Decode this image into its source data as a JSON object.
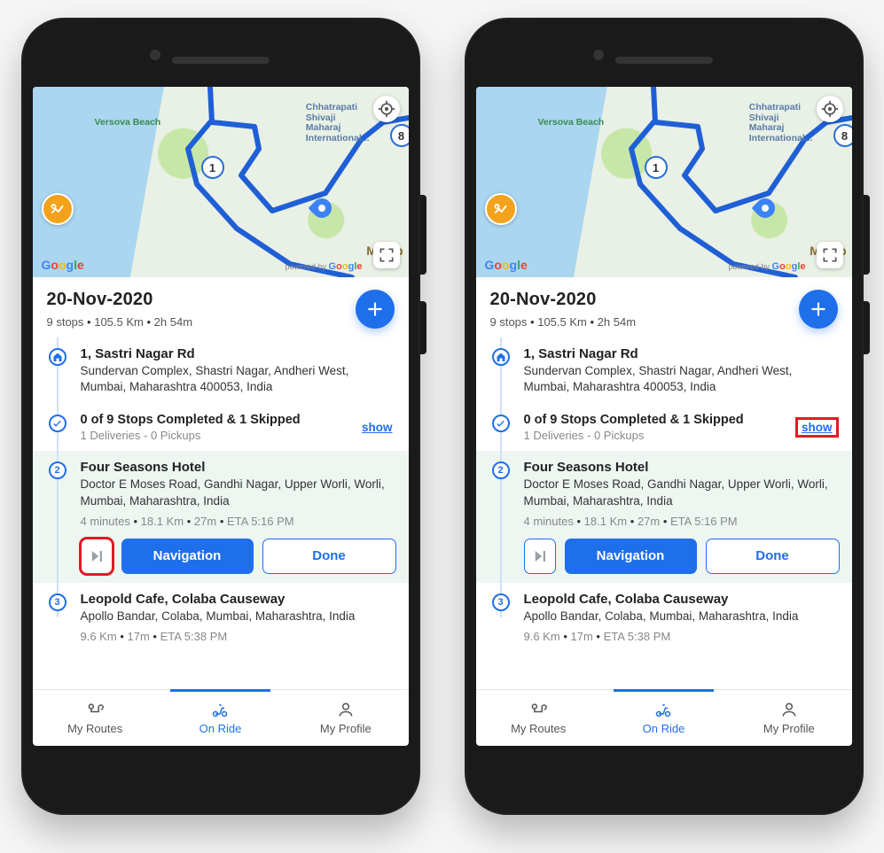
{
  "header": {
    "date": "20-Nov-2020",
    "stops": "9 stops",
    "distance": "105.5 Km",
    "duration": "2h 54m"
  },
  "map": {
    "label_versova": "Versova Beach",
    "label_airport_l1": "Chhatrapati",
    "label_airport_l2": "Shivaji",
    "label_airport_l3": "Maharaj",
    "label_airport_l4": "International...",
    "label_mumbai": "Mumb",
    "pin1": "1",
    "pin8": "8",
    "google": "Google",
    "powered": "powered by"
  },
  "stops": {
    "home": {
      "title": "1, Sastri Nagar Rd",
      "addr": "Sundervan Complex, Shastri Nagar, Andheri West, Mumbai, Maharashtra 400053, India"
    },
    "progress": {
      "title": "0 of 9 Stops Completed & 1 Skipped",
      "sub": "1 Deliveries -  0 Pickups",
      "show": "show"
    },
    "s2": {
      "num": "2",
      "title": "Four Seasons Hotel",
      "addr": "Doctor E Moses Road, Gandhi Nagar, Upper Worli, Worli, Mumbai, Maharashtra, India",
      "meta_wait": "4 minutes",
      "meta_dist": "18.1 Km",
      "meta_dur": "27m",
      "meta_eta": "ETA 5:16 PM",
      "nav": "Navigation",
      "done": "Done"
    },
    "s3": {
      "num": "3",
      "title": "Leopold Cafe, Colaba Causeway",
      "addr": "Apollo Bandar, Colaba, Mumbai, Maharashtra, India",
      "meta_dist": "9.6 Km",
      "meta_dur": "17m",
      "meta_eta": "ETA 5:38 PM"
    }
  },
  "bottom": {
    "routes": "My Routes",
    "onride": "On Ride",
    "profile": "My Profile"
  },
  "annotations": {
    "left_highlight": "skip",
    "right_highlight": "show"
  }
}
